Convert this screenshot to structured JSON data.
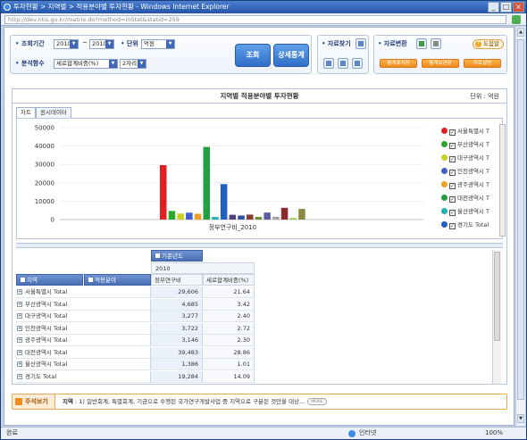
{
  "window": {
    "title": "투자현황 > 지역별 > 적용분야별 투자현황 - Windows Internet Explorer",
    "address": "http://dev.ntis.go.kr/matrix.do?method=inStat&statid=259"
  },
  "status": {
    "left": "완료",
    "zone": "인터넷",
    "zoom": "100%"
  },
  "toolbar": {
    "period_label": "조회기간",
    "year_from": "2010",
    "year_sep": "~",
    "year_to": "2010",
    "unit_label": "단위",
    "unit_value": "억원",
    "func_label": "분석함수",
    "func_value": "세로합계비중(%)",
    "digits_value": "2자리",
    "search_btn": "조회",
    "detail_btn": "상세통계",
    "find_label": "자료찾기",
    "convert_label": "자료변환",
    "help_btn": "도움말",
    "btn_stat_save": "통계표저장",
    "btn_stat_info": "통계보관함",
    "btn_data_desc": "자료설명"
  },
  "report": {
    "title": "지역별 적용분야별 투자현황",
    "unit": "단위 : 억원",
    "tabs": [
      "차트",
      "원시데이터"
    ]
  },
  "chart_data": {
    "type": "bar",
    "title": "",
    "xlabel": "정부연구비_2010",
    "ylabel": "",
    "ylim": [
      0,
      50000
    ],
    "yticks": [
      "0",
      "10000",
      "20000",
      "30000",
      "40000",
      "50000"
    ],
    "categories": [
      "정부연구비_2010"
    ],
    "series": [
      {
        "name": "서울특별시 Total",
        "value": 29606,
        "color": "#e02020"
      },
      {
        "name": "부산광역시 Total",
        "value": 4685,
        "color": "#2aa82a"
      },
      {
        "name": "대구광역시 Total",
        "value": 3277,
        "color": "#c8d21c"
      },
      {
        "name": "인천광역시 Total",
        "value": 3722,
        "color": "#4060d0"
      },
      {
        "name": "광주광역시 Total",
        "value": 3146,
        "color": "#f0a020"
      },
      {
        "name": "대전광역시 Total",
        "value": 39483,
        "color": "#20a040"
      },
      {
        "name": "울산광역시 Total",
        "value": 1386,
        "color": "#20b0b0"
      },
      {
        "name": "경기도 Total",
        "value": 19284,
        "color": "#2060c0"
      },
      {
        "name": "",
        "value": 2600,
        "color": "#504080"
      },
      {
        "name": "",
        "value": 2200,
        "color": "#3050a0"
      },
      {
        "name": "",
        "value": 2700,
        "color": "#8a3a3a"
      },
      {
        "name": "",
        "value": 1400,
        "color": "#6a8a2a"
      },
      {
        "name": "",
        "value": 3800,
        "color": "#5a5aa0"
      },
      {
        "name": "",
        "value": 1500,
        "color": "#a0a0a0"
      },
      {
        "name": "",
        "value": 6400,
        "color": "#8a2a2a"
      },
      {
        "name": "",
        "value": 800,
        "color": "#a0c040"
      },
      {
        "name": "",
        "value": 5800,
        "color": "#8a8a40"
      }
    ]
  },
  "legend": [
    {
      "label": "서울특별시 T",
      "color": "#e02020"
    },
    {
      "label": "부산광역시 T",
      "color": "#2aa82a"
    },
    {
      "label": "대구광역시 T",
      "color": "#c8d21c"
    },
    {
      "label": "인천광역시 T",
      "color": "#4060d0"
    },
    {
      "label": "광주광역시 T",
      "color": "#f0a020"
    },
    {
      "label": "대전광역시 T",
      "color": "#20a040"
    },
    {
      "label": "울산광역시 T",
      "color": "#20b0b0"
    },
    {
      "label": "경기도 Total",
      "color": "#2060c0"
    }
  ],
  "table": {
    "pivot_col_header": "기준년도",
    "pivot_year": "2010",
    "row_header_1": "지역",
    "row_header_2": "적용분야",
    "col_1": "정부연구비",
    "col_2": "세로합계비중(%)",
    "rows": [
      {
        "region": "서울특별시 Total",
        "amount": "29,606",
        "pct": "21.64"
      },
      {
        "region": "부산광역시 Total",
        "amount": "4,685",
        "pct": "3.42"
      },
      {
        "region": "대구광역시 Total",
        "amount": "3,277",
        "pct": "2.40"
      },
      {
        "region": "인천광역시 Total",
        "amount": "3,722",
        "pct": "2.72"
      },
      {
        "region": "광주광역시 Total",
        "amount": "3,146",
        "pct": "2.30"
      },
      {
        "region": "대전광역시 Total",
        "amount": "39,483",
        "pct": "28.86"
      },
      {
        "region": "울산광역시 Total",
        "amount": "1,386",
        "pct": "1.01"
      },
      {
        "region": "경기도 Total",
        "amount": "19,284",
        "pct": "14.09"
      }
    ]
  },
  "note": {
    "label": "주석보기",
    "subject": "지역",
    "text": " : 1) 일반회계, 특별회계, 기금으로 수행된 국가연구개발사업 중 지역으로 구분된 것만을 대상...",
    "more": "MORE"
  }
}
